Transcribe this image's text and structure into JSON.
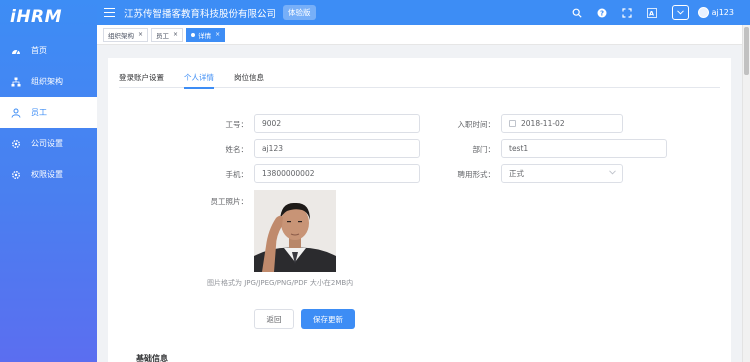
{
  "app": {
    "logo": "iHRM",
    "company": "江苏传智播客教育科技股份有限公司",
    "trial_badge": "体验版",
    "username": "aj123"
  },
  "sidebar": {
    "items": [
      {
        "label": "首页",
        "icon": "dashboard-icon"
      },
      {
        "label": "组织架构",
        "icon": "org-tree-icon"
      },
      {
        "label": "员工",
        "icon": "employee-icon"
      },
      {
        "label": "公司设置",
        "icon": "gear-icon"
      },
      {
        "label": "权限设置",
        "icon": "settings-icon"
      }
    ]
  },
  "tags": [
    {
      "label": "组织架构",
      "close": "×"
    },
    {
      "label": "员工",
      "close": "×"
    },
    {
      "label": "详情",
      "close": "×"
    }
  ],
  "tabs": [
    {
      "label": "登录账户设置"
    },
    {
      "label": "个人详情"
    },
    {
      "label": "岗位信息"
    }
  ],
  "form": {
    "job_number_label": "工号：",
    "job_number": "9002",
    "entry_date_label": "入职时间：",
    "entry_date": "2018-11-02",
    "name_label": "姓名：",
    "name": "aj123",
    "dept_label": "部门：",
    "dept": "test1",
    "mobile_label": "手机：",
    "mobile": "13800000002",
    "form_type_label": "聘用形式：",
    "form_type": "正式",
    "photo_label": "员工照片：",
    "photo_hint": "图片格式为 JPG/JPEG/PNG/PDF 大小在2MB内",
    "back_label": "返回",
    "save_label": "保存更新",
    "section_title": "基础信息"
  },
  "colors": {
    "accent": "#3d8df5",
    "sidebar_top": "#3d8df5",
    "sidebar_bottom": "#5b6ef0"
  }
}
